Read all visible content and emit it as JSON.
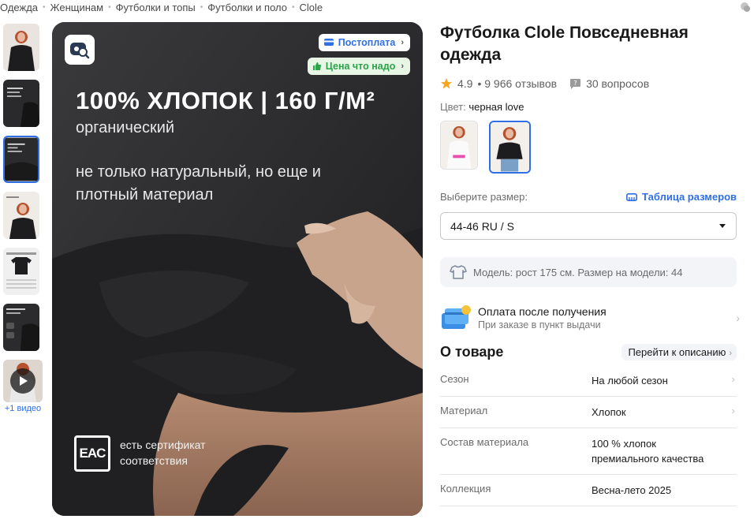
{
  "breadcrumbs": [
    "Одежда",
    "Женщинам",
    "Футболки и топы",
    "Футболки и поло",
    "Clole"
  ],
  "gallery": {
    "video_label": "+1 видео"
  },
  "main_image": {
    "badge_postpay": "Постоплата",
    "badge_price": "Цена что надо",
    "headline": "100% ХЛОПОК | 160 Г/М²",
    "subline": "органический",
    "desc": "не только натуральный, но еще и плотный материал",
    "eac": "EAC",
    "cert": "есть сертификат соответствия"
  },
  "product": {
    "title": "Футболка Clole Повседневная одежда",
    "rating": "4.9",
    "reviews": "• 9 966 отзывов",
    "questions": "30 вопросов",
    "color_label": "Цвет:",
    "color_value": "черная love",
    "size_label": "Выберите размер:",
    "size_table": "Таблица размеров",
    "size_selected": "44-46 RU / S",
    "model_info": "Модель: рост 175 см. Размер на модели: 44",
    "payment_title": "Оплата после получения",
    "payment_sub": "При заказе в пункт выдачи"
  },
  "about": {
    "title": "О товаре",
    "link": "Перейти к описанию",
    "specs": [
      {
        "key": "Сезон",
        "value": "На любой сезон"
      },
      {
        "key": "Материал",
        "value": "Хлопок"
      },
      {
        "key": "Состав материала",
        "value": "100 % хлопок премиального качества"
      },
      {
        "key": "Коллекция",
        "value": "Весна-лето 2025"
      }
    ]
  },
  "colors": {
    "accent": "#2f6fe4",
    "green": "#2ba34a",
    "star": "#f5a623"
  }
}
